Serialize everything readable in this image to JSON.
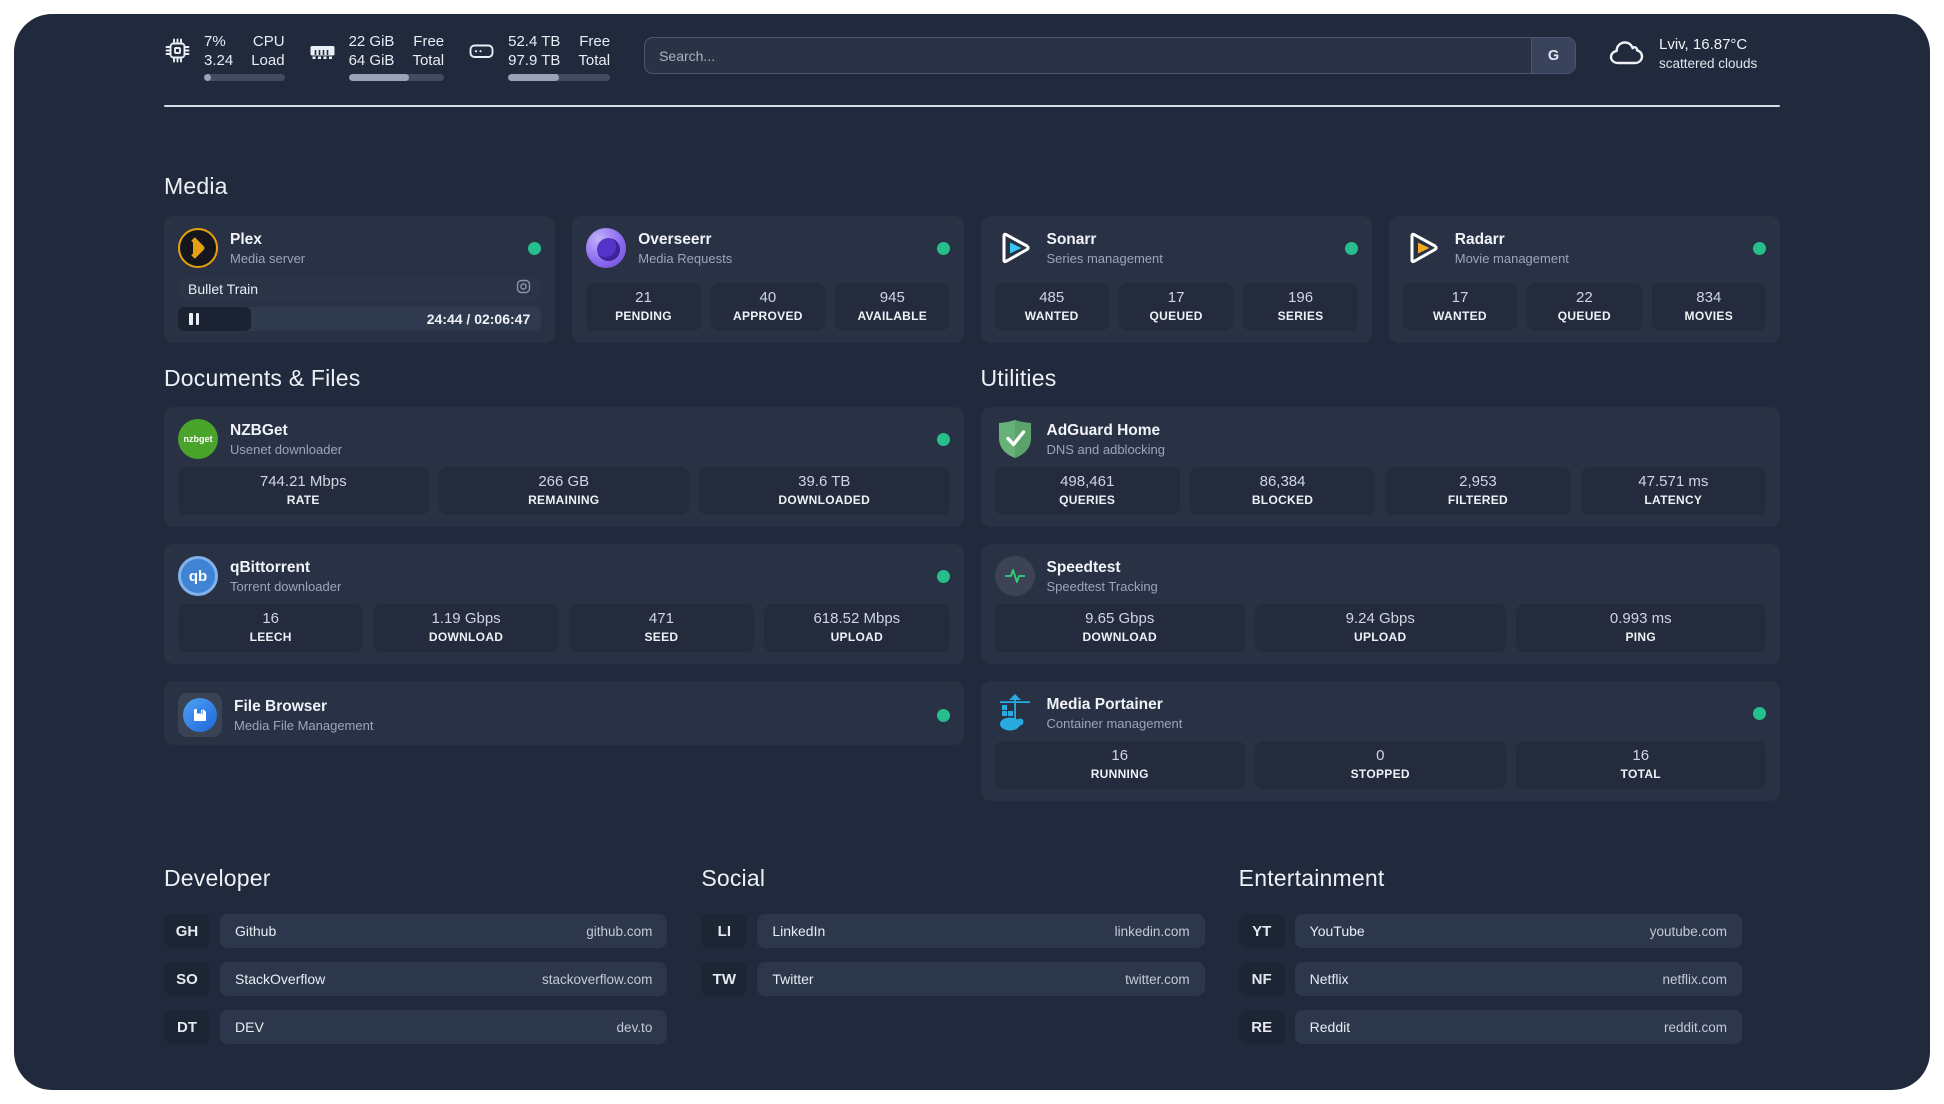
{
  "header": {
    "cpu": {
      "value_top": "7%",
      "value_bottom": "3.24",
      "label_top": "CPU",
      "label_bottom": "Load",
      "progress_pct": 9
    },
    "memory": {
      "value_top": "22 GiB",
      "value_bottom": "64 GiB",
      "label_top": "Free",
      "label_bottom": "Total",
      "progress_pct": 63
    },
    "disk": {
      "value_top": "52.4 TB",
      "value_bottom": "97.9 TB",
      "label_top": "Free",
      "label_bottom": "Total",
      "progress_pct": 50
    },
    "search": {
      "placeholder": "Search...",
      "engine_label": "G"
    },
    "weather": {
      "summary": "Lviv, 16.87°C",
      "condition": "scattered clouds"
    }
  },
  "sections": {
    "media": {
      "title": "Media",
      "plex": {
        "name": "Plex",
        "description": "Media server",
        "status_online": true,
        "now_playing": {
          "title": "Bullet Train",
          "time": "24:44 / 02:06:47",
          "progress_pct": 20
        }
      },
      "overseerr": {
        "name": "Overseerr",
        "description": "Media Requests",
        "status_online": true,
        "stats": [
          {
            "value": "21",
            "label": "PENDING"
          },
          {
            "value": "40",
            "label": "APPROVED"
          },
          {
            "value": "945",
            "label": "AVAILABLE"
          }
        ]
      },
      "sonarr": {
        "name": "Sonarr",
        "description": "Series management",
        "status_online": true,
        "stats": [
          {
            "value": "485",
            "label": "WANTED"
          },
          {
            "value": "17",
            "label": "QUEUED"
          },
          {
            "value": "196",
            "label": "SERIES"
          }
        ]
      },
      "radarr": {
        "name": "Radarr",
        "description": "Movie management",
        "status_online": true,
        "stats": [
          {
            "value": "17",
            "label": "WANTED"
          },
          {
            "value": "22",
            "label": "QUEUED"
          },
          {
            "value": "834",
            "label": "MOVIES"
          }
        ]
      }
    },
    "documents": {
      "title": "Documents & Files",
      "nzbget": {
        "name": "NZBGet",
        "description": "Usenet downloader",
        "status_online": true,
        "icon_text": "nzbget",
        "stats": [
          {
            "value": "744.21 Mbps",
            "label": "RATE"
          },
          {
            "value": "266 GB",
            "label": "REMAINING"
          },
          {
            "value": "39.6 TB",
            "label": "DOWNLOADED"
          }
        ]
      },
      "qbittorrent": {
        "name": "qBittorrent",
        "description": "Torrent downloader",
        "status_online": true,
        "icon_text": "qb",
        "stats": [
          {
            "value": "16",
            "label": "LEECH"
          },
          {
            "value": "1.19 Gbps",
            "label": "DOWNLOAD"
          },
          {
            "value": "471",
            "label": "SEED"
          },
          {
            "value": "618.52 Mbps",
            "label": "UPLOAD"
          }
        ]
      },
      "filebrowser": {
        "name": "File Browser",
        "description": "Media File Management",
        "status_online": true
      }
    },
    "utilities": {
      "title": "Utilities",
      "adguard": {
        "name": "AdGuard Home",
        "description": "DNS and adblocking",
        "stats": [
          {
            "value": "498,461",
            "label": "QUERIES"
          },
          {
            "value": "86,384",
            "label": "BLOCKED"
          },
          {
            "value": "2,953",
            "label": "FILTERED"
          },
          {
            "value": "47.571 ms",
            "label": "LATENCY"
          }
        ]
      },
      "speedtest": {
        "name": "Speedtest",
        "description": "Speedtest Tracking",
        "stats": [
          {
            "value": "9.65 Gbps",
            "label": "DOWNLOAD"
          },
          {
            "value": "9.24 Gbps",
            "label": "UPLOAD"
          },
          {
            "value": "0.993 ms",
            "label": "PING"
          }
        ]
      },
      "portainer": {
        "name": "Media Portainer",
        "description": "Container management",
        "status_online": true,
        "stats": [
          {
            "value": "16",
            "label": "RUNNING"
          },
          {
            "value": "0",
            "label": "STOPPED"
          },
          {
            "value": "16",
            "label": "TOTAL"
          }
        ]
      }
    },
    "developer": {
      "title": "Developer",
      "links": [
        {
          "abbr": "GH",
          "name": "Github",
          "url": "github.com"
        },
        {
          "abbr": "SO",
          "name": "StackOverflow",
          "url": "stackoverflow.com"
        },
        {
          "abbr": "DT",
          "name": "DEV",
          "url": "dev.to"
        }
      ]
    },
    "social": {
      "title": "Social",
      "links": [
        {
          "abbr": "LI",
          "name": "LinkedIn",
          "url": "linkedin.com"
        },
        {
          "abbr": "TW",
          "name": "Twitter",
          "url": "twitter.com"
        }
      ]
    },
    "entertainment": {
      "title": "Entertainment",
      "links": [
        {
          "abbr": "YT",
          "name": "YouTube",
          "url": "youtube.com"
        },
        {
          "abbr": "NF",
          "name": "Netflix",
          "url": "netflix.com"
        },
        {
          "abbr": "RE",
          "name": "Reddit",
          "url": "reddit.com"
        }
      ]
    }
  },
  "colors": {
    "background": "#212a3c",
    "card": "#293144",
    "tile": "#232b3d",
    "status_online": "#26be8c",
    "divider": "#d5dbe4"
  }
}
